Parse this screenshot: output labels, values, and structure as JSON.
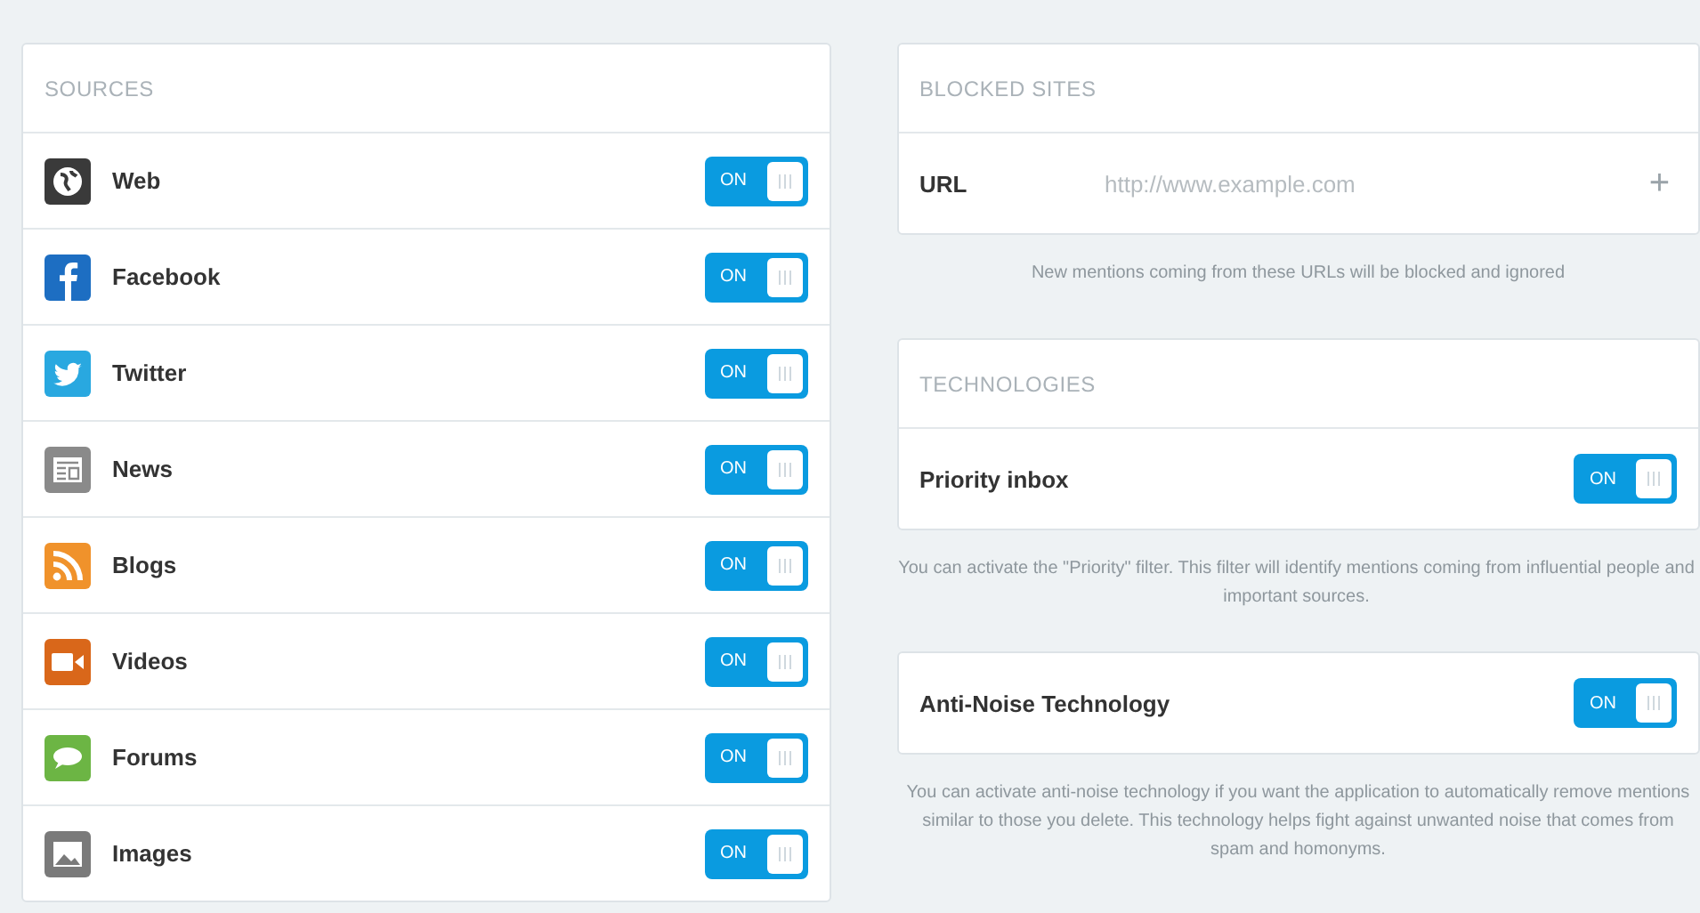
{
  "sources": {
    "title": "SOURCES",
    "items": [
      {
        "kind": "web",
        "label": "Web",
        "on": true,
        "toggle_text": "ON"
      },
      {
        "kind": "facebook",
        "label": "Facebook",
        "on": true,
        "toggle_text": "ON"
      },
      {
        "kind": "twitter",
        "label": "Twitter",
        "on": true,
        "toggle_text": "ON"
      },
      {
        "kind": "news",
        "label": "News",
        "on": true,
        "toggle_text": "ON"
      },
      {
        "kind": "blogs",
        "label": "Blogs",
        "on": true,
        "toggle_text": "ON"
      },
      {
        "kind": "videos",
        "label": "Videos",
        "on": true,
        "toggle_text": "ON"
      },
      {
        "kind": "forums",
        "label": "Forums",
        "on": true,
        "toggle_text": "ON"
      },
      {
        "kind": "images",
        "label": "Images",
        "on": true,
        "toggle_text": "ON"
      }
    ]
  },
  "blocked_sites": {
    "title": "BLOCKED SITES",
    "field_label": "URL",
    "placeholder": "http://www.example.com",
    "add_icon_text": "+",
    "help": "New mentions coming from these URLs will be blocked and ignored"
  },
  "technologies": {
    "title": "TECHNOLOGIES",
    "items": [
      {
        "label": "Priority inbox",
        "on": true,
        "toggle_text": "ON",
        "help": "You can activate the \"Priority\" filter. This filter will identify mentions coming from influential people and important sources."
      },
      {
        "label": "Anti-Noise Technology",
        "on": true,
        "toggle_text": "ON",
        "help": "You can activate anti-noise technology if you want the application to automatically remove mentions similar to those you delete. This technology helps fight against unwanted noise that comes from spam and homonyms."
      }
    ]
  }
}
